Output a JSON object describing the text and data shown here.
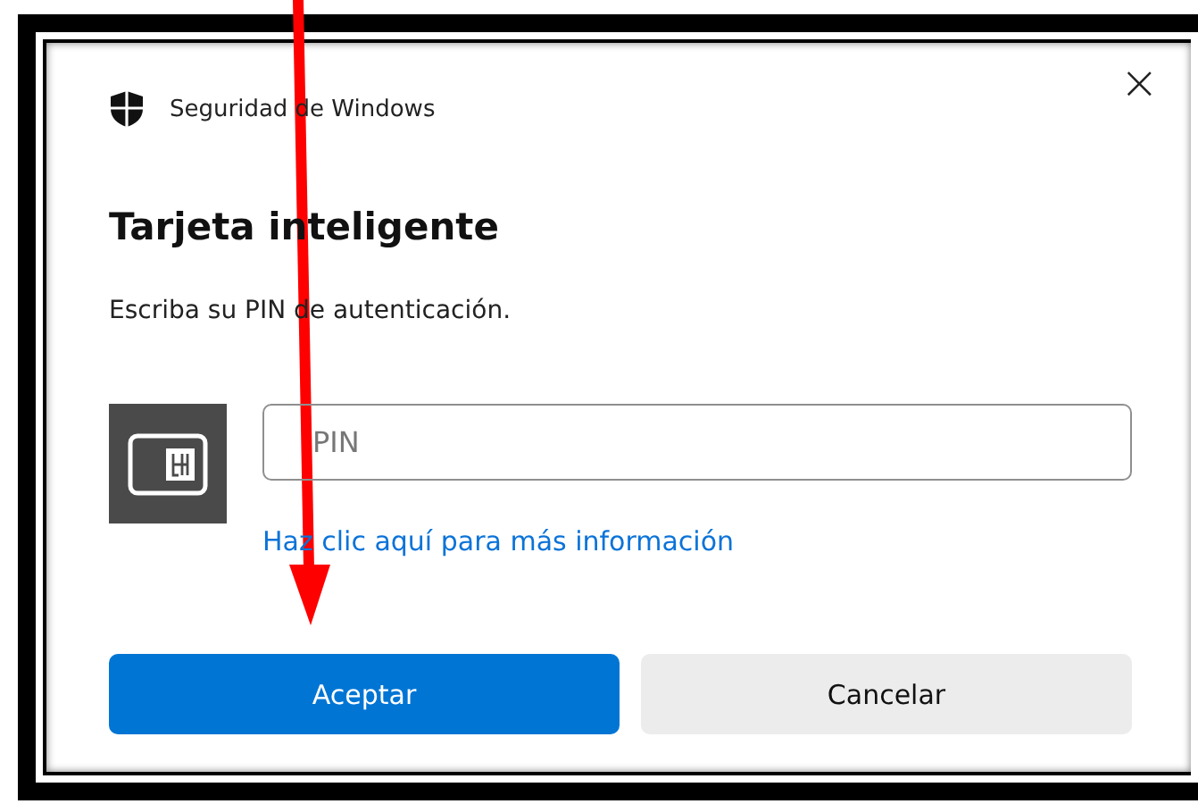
{
  "window": {
    "title": "Seguridad de Windows",
    "close": "×"
  },
  "heading": "Tarjeta inteligente",
  "instruction": "Escriba su PIN de autenticación.",
  "pin_field": {
    "placeholder": "PIN"
  },
  "link": "Haz clic aquí para más información",
  "buttons": [
    {
      "label": "Aceptar",
      "kind": "primary"
    },
    {
      "label": "Cancelar",
      "kind": "secondary"
    }
  ]
}
